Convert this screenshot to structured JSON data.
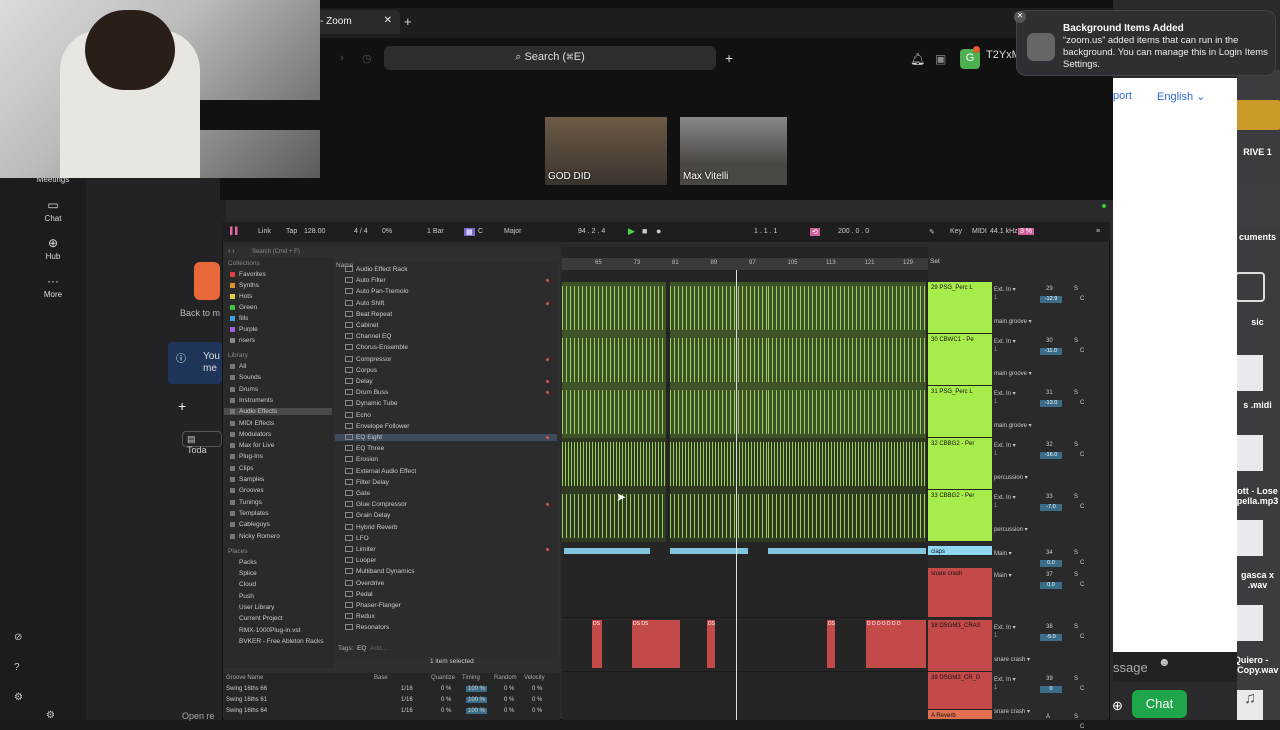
{
  "zoom": {
    "tab_title": "- Zoom",
    "search_label": "Search (⌘E)",
    "id_fragment": "T2YxM",
    "avatar_letter": "G",
    "participants": [
      {
        "name": "GOD DID"
      },
      {
        "name": "Max Vitelli"
      }
    ],
    "sidebar": [
      {
        "label": "Meetings"
      },
      {
        "label": "Chat"
      },
      {
        "label": "Hub"
      },
      {
        "label": "More"
      }
    ],
    "back_label": "Back to m",
    "info_text": "You\nme",
    "today_label": "Toda",
    "open_label": "Open re"
  },
  "notification": {
    "title": "Background Items Added",
    "body": "“zoom.us” added items that can run in the background. You can manage this in Login Items Settings."
  },
  "webpage": {
    "support": "port",
    "language": "English",
    "message_placeholder": "ssage",
    "chat_button": "Chat"
  },
  "desktop": {
    "items": [
      {
        "label": "RIVE 1"
      },
      {
        "label": "cuments"
      },
      {
        "label": "sic"
      },
      {
        "label": "s .midi"
      },
      {
        "label": "ott - Lose\npella.mp3"
      },
      {
        "label": "gasca x\n.wav"
      },
      {
        "label": "Te Quiero -\nXGa...Copy.wav"
      }
    ]
  },
  "ableton": {
    "toolbar": {
      "link": "Link",
      "tap": "Tap",
      "tempo": "128.00",
      "signature": "4 / 4",
      "percent": "0%",
      "quantize": "1 Bar",
      "key": "C",
      "scale": "Major",
      "position": "94 .  2 .  4",
      "loop_start": "1 .  1 .  1",
      "loop_len": "200 .  0 .  0",
      "key_label": "Key",
      "midi_label": "MIDI",
      "sample_rate": "44.1 kHz",
      "cpu": "3 %"
    },
    "search_placeholder": "Search (Cmd + F)",
    "collections_header": "Collections",
    "collections": [
      {
        "label": "Favorites",
        "color": "#e04040"
      },
      {
        "label": "Synths",
        "color": "#e09030"
      },
      {
        "label": "Hots",
        "color": "#e0d040"
      },
      {
        "label": "Green",
        "color": "#40c040"
      },
      {
        "label": "fills",
        "color": "#40a0e0"
      },
      {
        "label": "Purple",
        "color": "#a060e0"
      },
      {
        "label": "risers",
        "color": "#888888"
      }
    ],
    "library_header": "Library",
    "library": [
      {
        "label": "All"
      },
      {
        "label": "Sounds"
      },
      {
        "label": "Drums"
      },
      {
        "label": "Instruments"
      },
      {
        "label": "Audio Effects",
        "selected": true
      },
      {
        "label": "MIDI Effects"
      },
      {
        "label": "Modulators"
      },
      {
        "label": "Max for Live"
      },
      {
        "label": "Plug-Ins"
      },
      {
        "label": "Clips"
      },
      {
        "label": "Samples"
      },
      {
        "label": "Grooves"
      },
      {
        "label": "Tunings"
      },
      {
        "label": "Templates"
      },
      {
        "label": "Cableguys"
      },
      {
        "label": "Nicky Romero"
      }
    ],
    "places_header": "Places",
    "places": [
      {
        "label": "Packs"
      },
      {
        "label": "Splice"
      },
      {
        "label": "Cloud"
      },
      {
        "label": "Push"
      },
      {
        "label": "User Library"
      },
      {
        "label": "Current Project"
      },
      {
        "label": "RMX-1000Plug-in.vst"
      },
      {
        "label": "BVKER - Free Ableton Racks"
      }
    ],
    "list_header": "Name",
    "devices": [
      {
        "label": "Audio Effect Rack"
      },
      {
        "label": "Auto Filter",
        "dot": true
      },
      {
        "label": "Auto Pan-Tremolo"
      },
      {
        "label": "Auto Shift",
        "dot": true
      },
      {
        "label": "Beat Repeat"
      },
      {
        "label": "Cabinet"
      },
      {
        "label": "Channel EQ"
      },
      {
        "label": "Chorus-Ensemble"
      },
      {
        "label": "Compressor",
        "dot": true
      },
      {
        "label": "Corpus"
      },
      {
        "label": "Delay",
        "dot": true
      },
      {
        "label": "Drum Buss",
        "dot": true
      },
      {
        "label": "Dynamic Tube"
      },
      {
        "label": "Echo"
      },
      {
        "label": "Envelope Follower"
      },
      {
        "label": "EQ Eight",
        "dot": true,
        "selected": true
      },
      {
        "label": "EQ Three"
      },
      {
        "label": "Erosion"
      },
      {
        "label": "External Audio Effect"
      },
      {
        "label": "Filter Delay"
      },
      {
        "label": "Gate"
      },
      {
        "label": "Glue Compressor",
        "dot": true
      },
      {
        "label": "Grain Delay"
      },
      {
        "label": "Hybrid Reverb"
      },
      {
        "label": "LFO"
      },
      {
        "label": "Limiter",
        "dot": true
      },
      {
        "label": "Looper"
      },
      {
        "label": "Multiband Dynamics"
      },
      {
        "label": "Overdrive"
      },
      {
        "label": "Pedal"
      },
      {
        "label": "Phaser-Flanger"
      },
      {
        "label": "Redux"
      },
      {
        "label": "Resonators"
      }
    ],
    "tags_label": "Tags:",
    "tags_value": "EQ",
    "tags_add": "Add...",
    "selected_status": "1 item selected",
    "groove": {
      "headers": [
        "Groove Name",
        "Base",
        "Quantize",
        "Timing",
        "Random",
        "Velocity"
      ],
      "rows": [
        {
          "name": "Swing 16ths 66",
          "base": "1/16",
          "q": "0 %",
          "t": "100 %",
          "r": "0 %",
          "v": "0 %"
        },
        {
          "name": "Swing 16ths 61",
          "base": "1/16",
          "q": "0 %",
          "t": "100 %",
          "r": "0 %",
          "v": "0 %"
        },
        {
          "name": "Swing 16ths 64",
          "base": "1/16",
          "q": "0 %",
          "t": "100 %",
          "r": "0 %",
          "v": "0 %"
        }
      ]
    },
    "ruler": [
      "65",
      "73",
      "81",
      "89",
      "97",
      "105",
      "113",
      "121",
      "129"
    ],
    "set_label": "Set",
    "tracks": [
      {
        "name": "29 PSG_Perc L",
        "input": "Ext. In",
        "ch": "1",
        "group": "main groove",
        "num": "29",
        "vol": "-12.9",
        "color": "#a6ec4a"
      },
      {
        "name": "30 CBWC1 - Pe",
        "input": "Ext. In",
        "ch": "1",
        "group": "main groove",
        "num": "30",
        "vol": "-11.0",
        "color": "#a6ec4a"
      },
      {
        "name": "31 PSG_Perc L",
        "input": "Ext. In",
        "ch": "1",
        "group": "main groove",
        "num": "31",
        "vol": "-13.0",
        "color": "#a6ec4a"
      },
      {
        "name": "32 CBBG2 - Per",
        "input": "Ext. In",
        "ch": "1",
        "group": "percussion",
        "num": "32",
        "vol": "-16.0",
        "color": "#a6ec4a"
      },
      {
        "name": "33 CBBG2 - Per",
        "input": "Ext. In",
        "ch": "1",
        "group": "percussion",
        "num": "33",
        "vol": "-7.0",
        "color": "#a6ec4a"
      },
      {
        "name": "claps",
        "input": "Main",
        "ch": "",
        "group": "",
        "num": "34",
        "vol": "0.0",
        "color": "#8fd8f2"
      },
      {
        "name": "snare crash",
        "input": "Main",
        "ch": "",
        "group": "",
        "num": "37",
        "vol": "0.0",
        "color": "#c44a4a"
      },
      {
        "name": "38 DSGM3_CRAS",
        "input": "Ext. In",
        "ch": "1",
        "group": "snare crash",
        "num": "38",
        "vol": "-5.0",
        "color": "#c44a4a"
      },
      {
        "name": "39 DSGM3_CR_D",
        "input": "Ext. In",
        "ch": "1",
        "group": "snare crash",
        "num": "39",
        "vol": "0",
        "color": "#c44a4a"
      },
      {
        "name": "A Reverb",
        "input": "",
        "ch": "",
        "group": "",
        "num": "A",
        "vol": "",
        "color": "#e07050"
      }
    ],
    "clip_labels": [
      "DS",
      "DS DS",
      "DS",
      "DS",
      "D D D D D D D"
    ]
  },
  "colors": {
    "green_clip": "#6f9a3a",
    "blue_clip": "#7fc6de",
    "red_clip": "#c44a4a",
    "accent_chat": "#1fa64a"
  }
}
